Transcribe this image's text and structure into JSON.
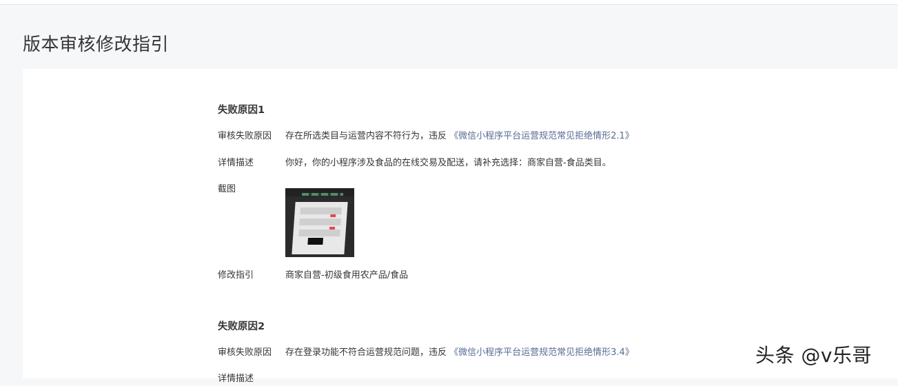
{
  "page": {
    "title": "版本审核修改指引"
  },
  "reasons": [
    {
      "title": "失败原因1",
      "audit_label": "审核失败原因",
      "audit_text": "存在所选类目与运营内容不符行为，违反",
      "audit_link": "《微信小程序平台运营规范常见拒绝情形2.1》",
      "detail_label": "详情描述",
      "detail_text": "你好，你的小程序涉及食品的在线交易及配送，请补充选择：商家自营-食品类目。",
      "screenshot_label": "截图",
      "guide_label": "修改指引",
      "guide_link": "商家自营-初级食用农产品/食品"
    },
    {
      "title": "失败原因2",
      "audit_label": "审核失败原因",
      "audit_text": "存在登录功能不符合运营规范问题，违反",
      "audit_link": "《微信小程序平台运营规范常见拒绝情形3.4》",
      "detail_label": "详情描述"
    }
  ],
  "watermark": "头条 @v乐哥",
  "colors": {
    "link": "#576b95",
    "background": "#f6f7f9",
    "card": "#ffffff"
  }
}
